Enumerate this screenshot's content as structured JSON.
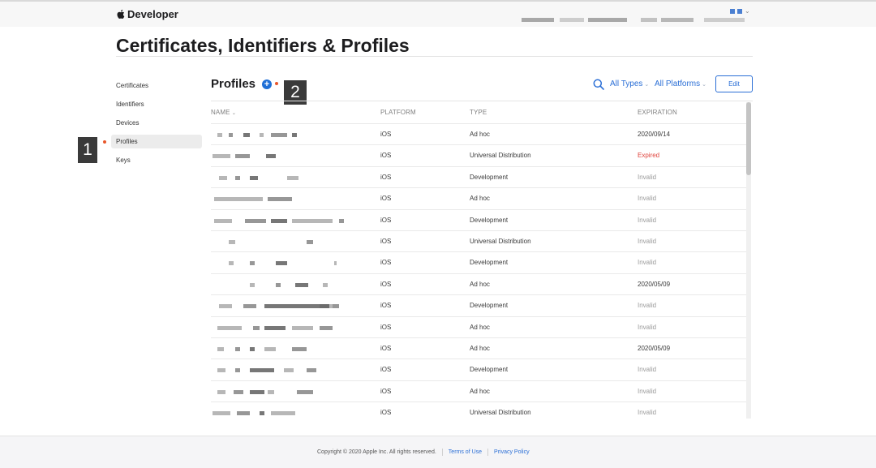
{
  "header": {
    "brand": "Developer",
    "brand_icon": "apple-logo-icon"
  },
  "page": {
    "title": "Certificates, Identifiers & Profiles"
  },
  "sidebar": {
    "items": [
      {
        "label": "Certificates",
        "active": false
      },
      {
        "label": "Identifiers",
        "active": false
      },
      {
        "label": "Devices",
        "active": false
      },
      {
        "label": "Profiles",
        "active": true
      },
      {
        "label": "Keys",
        "active": false
      }
    ]
  },
  "callouts": {
    "one": "1",
    "two": "2",
    "color": "#3a3a3a",
    "dot_color": "#e8562a"
  },
  "content": {
    "heading": "Profiles",
    "add_icon": "plus-circle-icon",
    "search_icon": "search-icon",
    "filter_types": "All Types",
    "filter_platforms": "All Platforms",
    "edit_label": "Edit",
    "accent": "#2b6fd6"
  },
  "table": {
    "columns": [
      "NAME",
      "PLATFORM",
      "TYPE",
      "EXPIRATION"
    ],
    "rows": [
      {
        "platform": "iOS",
        "type": "Ad hoc",
        "expiration": "2020/09/14",
        "status": "date"
      },
      {
        "platform": "iOS",
        "type": "Universal Distribution",
        "expiration": "Expired",
        "status": "expired"
      },
      {
        "platform": "iOS",
        "type": "Development",
        "expiration": "Invalid",
        "status": "invalid"
      },
      {
        "platform": "iOS",
        "type": "Ad hoc",
        "expiration": "Invalid",
        "status": "invalid"
      },
      {
        "platform": "iOS",
        "type": "Development",
        "expiration": "Invalid",
        "status": "invalid"
      },
      {
        "platform": "iOS",
        "type": "Universal Distribution",
        "expiration": "Invalid",
        "status": "invalid"
      },
      {
        "platform": "iOS",
        "type": "Development",
        "expiration": "Invalid",
        "status": "invalid"
      },
      {
        "platform": "iOS",
        "type": "Ad hoc",
        "expiration": "2020/05/09",
        "status": "date"
      },
      {
        "platform": "iOS",
        "type": "Development",
        "expiration": "Invalid",
        "status": "invalid"
      },
      {
        "platform": "iOS",
        "type": "Ad hoc",
        "expiration": "Invalid",
        "status": "invalid"
      },
      {
        "platform": "iOS",
        "type": "Ad hoc",
        "expiration": "2020/05/09",
        "status": "date"
      },
      {
        "platform": "iOS",
        "type": "Development",
        "expiration": "Invalid",
        "status": "invalid"
      },
      {
        "platform": "iOS",
        "type": "Ad hoc",
        "expiration": "Invalid",
        "status": "invalid"
      },
      {
        "platform": "iOS",
        "type": "Universal Distribution",
        "expiration": "Invalid",
        "status": "invalid"
      }
    ],
    "expired_color": "#e0443e",
    "invalid_color": "#9a9a9a"
  },
  "footer": {
    "copyright": "Copyright © 2020 Apple Inc. All rights reserved.",
    "terms": "Terms of Use",
    "privacy": "Privacy Policy"
  }
}
